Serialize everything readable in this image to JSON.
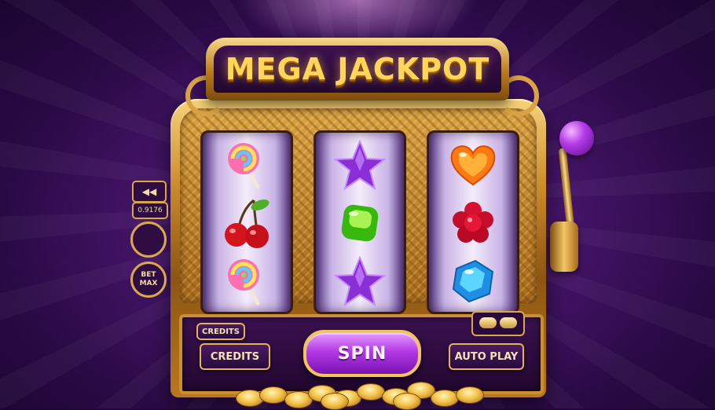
{
  "header": {
    "title": "MEGA JACKPOT"
  },
  "reels": [
    {
      "symbols": [
        "lollipop-icon",
        "cherry-icon",
        "lollipop-icon"
      ]
    },
    {
      "symbols": [
        "star-icon",
        "green-gem-icon",
        "star-icon"
      ]
    },
    {
      "symbols": [
        "heart-candy-icon",
        "raspberry-candy-icon",
        "blue-gem-icon"
      ]
    }
  ],
  "controls": {
    "credits_small": "CREDITS",
    "credits_button": "CREDITS",
    "spin_button": "SPIN",
    "auto_play_button": "AUTO PLAY"
  },
  "side": {
    "back_icon": "◀◀",
    "value": "0.9176",
    "bet_max_line1": "BET",
    "bet_max_line2": "MAX"
  },
  "colors": {
    "gold": "#d9a84a",
    "purple_dark": "#2a0a3c",
    "spin_purple": "#b339e6",
    "title_yellow": "#ffd65a"
  }
}
